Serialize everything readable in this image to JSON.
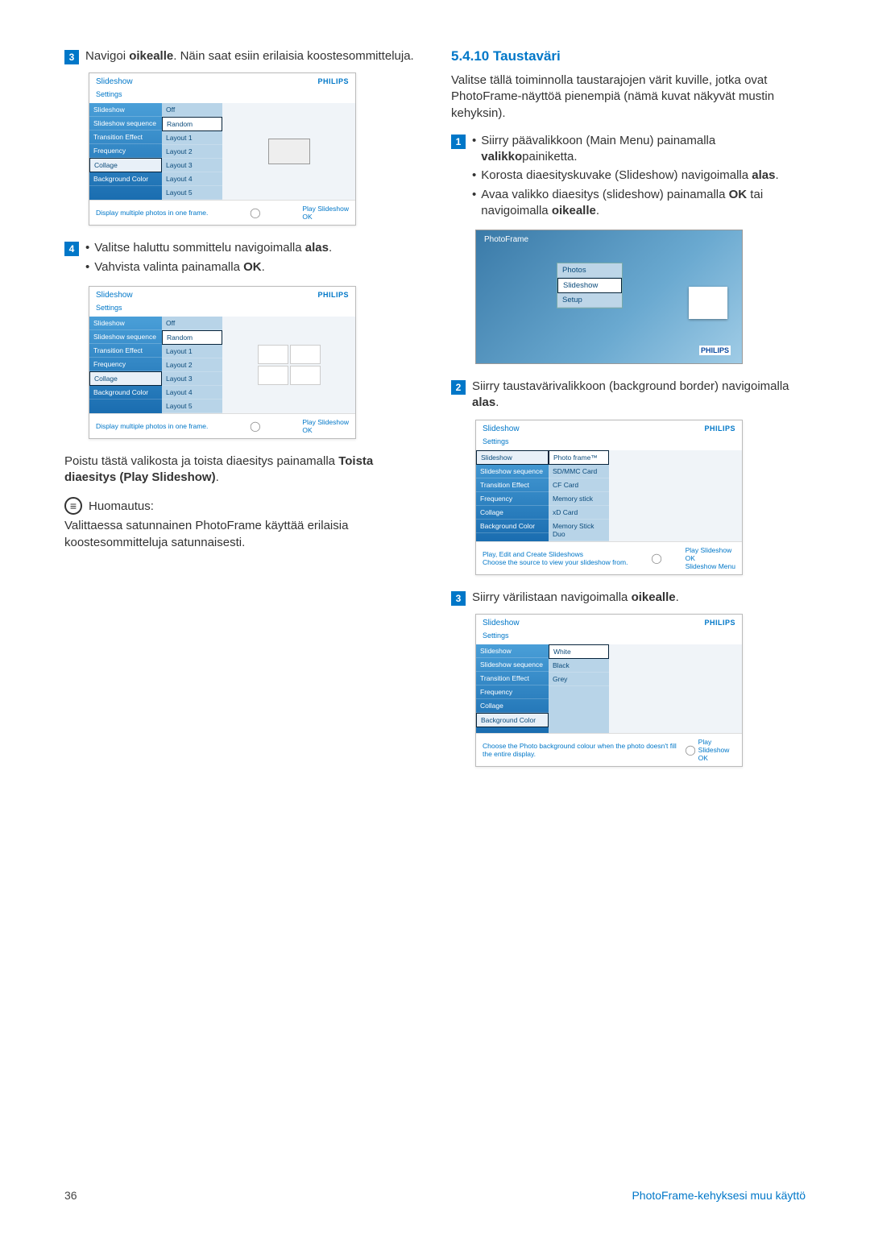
{
  "left": {
    "step3": {
      "num": "3",
      "text_parts": [
        "Navigoi ",
        "oikealle",
        ". Näin saat esiin erilaisia koostesommitteluja."
      ]
    },
    "step4": {
      "num": "4",
      "b1_parts": [
        "Valitse haluttu sommittelu navigoimalla ",
        "alas",
        "."
      ],
      "b2_parts": [
        "Vahvista valinta painamalla ",
        "OK",
        "."
      ]
    },
    "exit_parts": [
      "Poistu tästä valikosta ja toista diaesitys painamalla ",
      "Toista diaesitys (Play Slideshow)",
      "."
    ],
    "note_label": "Huomautus:",
    "note_body": "Valittaessa satunnainen PhotoFrame käyttää erilaisia koostesommitteluja satunnaisesti."
  },
  "right": {
    "heading": "5.4.10  Taustaväri",
    "intro": "Valitse tällä toiminnolla taustarajojen värit kuville, jotka ovat PhotoFrame-näyttöä pienempiä (nämä kuvat näkyvät mustin kehyksin).",
    "step1": {
      "num": "1",
      "b1_parts": [
        "Siirry päävalikkoon (Main Menu) painamalla ",
        "valikko",
        "painiketta."
      ],
      "b2_parts": [
        "Korosta diaesityskuvake (Slideshow) navigoimalla ",
        "alas",
        "."
      ],
      "b3_parts": [
        "Avaa valikko diaesitys (slideshow) painamalla ",
        "OK",
        " tai navigoimalla ",
        "oikealle",
        "."
      ]
    },
    "step2": {
      "num": "2",
      "text_parts": [
        "Siirry taustavärivalikkoon (background border) navigoimalla ",
        "alas",
        "."
      ]
    },
    "step3": {
      "num": "3",
      "text_parts": [
        "Siirry värilistaan navigoimalla ",
        "oikealle",
        "."
      ]
    }
  },
  "screens": {
    "brand": "PHILIPS",
    "layoutShot": {
      "title": "Slideshow",
      "sub": "Settings",
      "menu": [
        "Slideshow",
        "Slideshow sequence",
        "Transition Effect",
        "Frequency",
        "Collage",
        "Background Color"
      ],
      "sel": "Collage",
      "opts": [
        "Off",
        "Random",
        "Layout 1",
        "Layout 2",
        "Layout 3",
        "Layout 4",
        "Layout 5"
      ],
      "optSel": "Random",
      "hint": "Display multiple photos in one frame.",
      "nav1": "Play Slideshow",
      "nav2": "OK"
    },
    "mainMenu": {
      "pf": "PhotoFrame",
      "items": [
        "Photos",
        "Slideshow",
        "Setup"
      ],
      "sel": "Slideshow"
    },
    "sourceShot": {
      "title": "Slideshow",
      "sub": "Settings",
      "menu": [
        "Slideshow",
        "Slideshow sequence",
        "Transition Effect",
        "Frequency",
        "Collage",
        "Background Color"
      ],
      "sel": "Slideshow",
      "opts": [
        "Photo frame™",
        "SD/MMC Card",
        "CF Card",
        "Memory stick",
        "xD Card",
        "Memory Stick Duo"
      ],
      "optSel": "Photo frame™",
      "hint1": "Play, Edit and Create Slideshows",
      "hint2": "Choose the source to view your slideshow from.",
      "nav1": "Play Slideshow",
      "nav2": "OK",
      "nav3": "Slideshow Menu"
    },
    "colorShot": {
      "title": "Slideshow",
      "sub": "Settings",
      "menu": [
        "Slideshow",
        "Slideshow sequence",
        "Transition Effect",
        "Frequency",
        "Collage",
        "Background Color"
      ],
      "sel": "Background Color",
      "opts": [
        "White",
        "Black",
        "Grey"
      ],
      "optSel": "White",
      "hint": "Choose the Photo background colour when the photo doesn't fill the entire display.",
      "nav1": "Play Slideshow",
      "nav2": "OK"
    }
  },
  "footer": {
    "page": "36",
    "label": "PhotoFrame-kehyksesi muu käyttö"
  }
}
